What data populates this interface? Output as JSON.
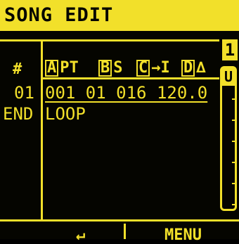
{
  "header": {
    "title": "SONG EDIT"
  },
  "columns": {
    "hash": "#",
    "pattern": {
      "box": "A",
      "text": "PT"
    },
    "bank": {
      "box": "B",
      "symbol": "S"
    },
    "length": {
      "box": "C",
      "symbol": "→I"
    },
    "tempo": {
      "box": "D",
      "symbol": "∆"
    }
  },
  "rows": [
    {
      "index": "01",
      "values": "001  01  016 120.0"
    },
    {
      "index": "END",
      "values": "LOOP"
    }
  ],
  "sidebar": {
    "badge": "1",
    "scroll_label": "U"
  },
  "softkeys": {
    "left": "↵",
    "right": "MENU"
  },
  "colors": {
    "foreground": "#f2e02a",
    "background": "#050500"
  }
}
